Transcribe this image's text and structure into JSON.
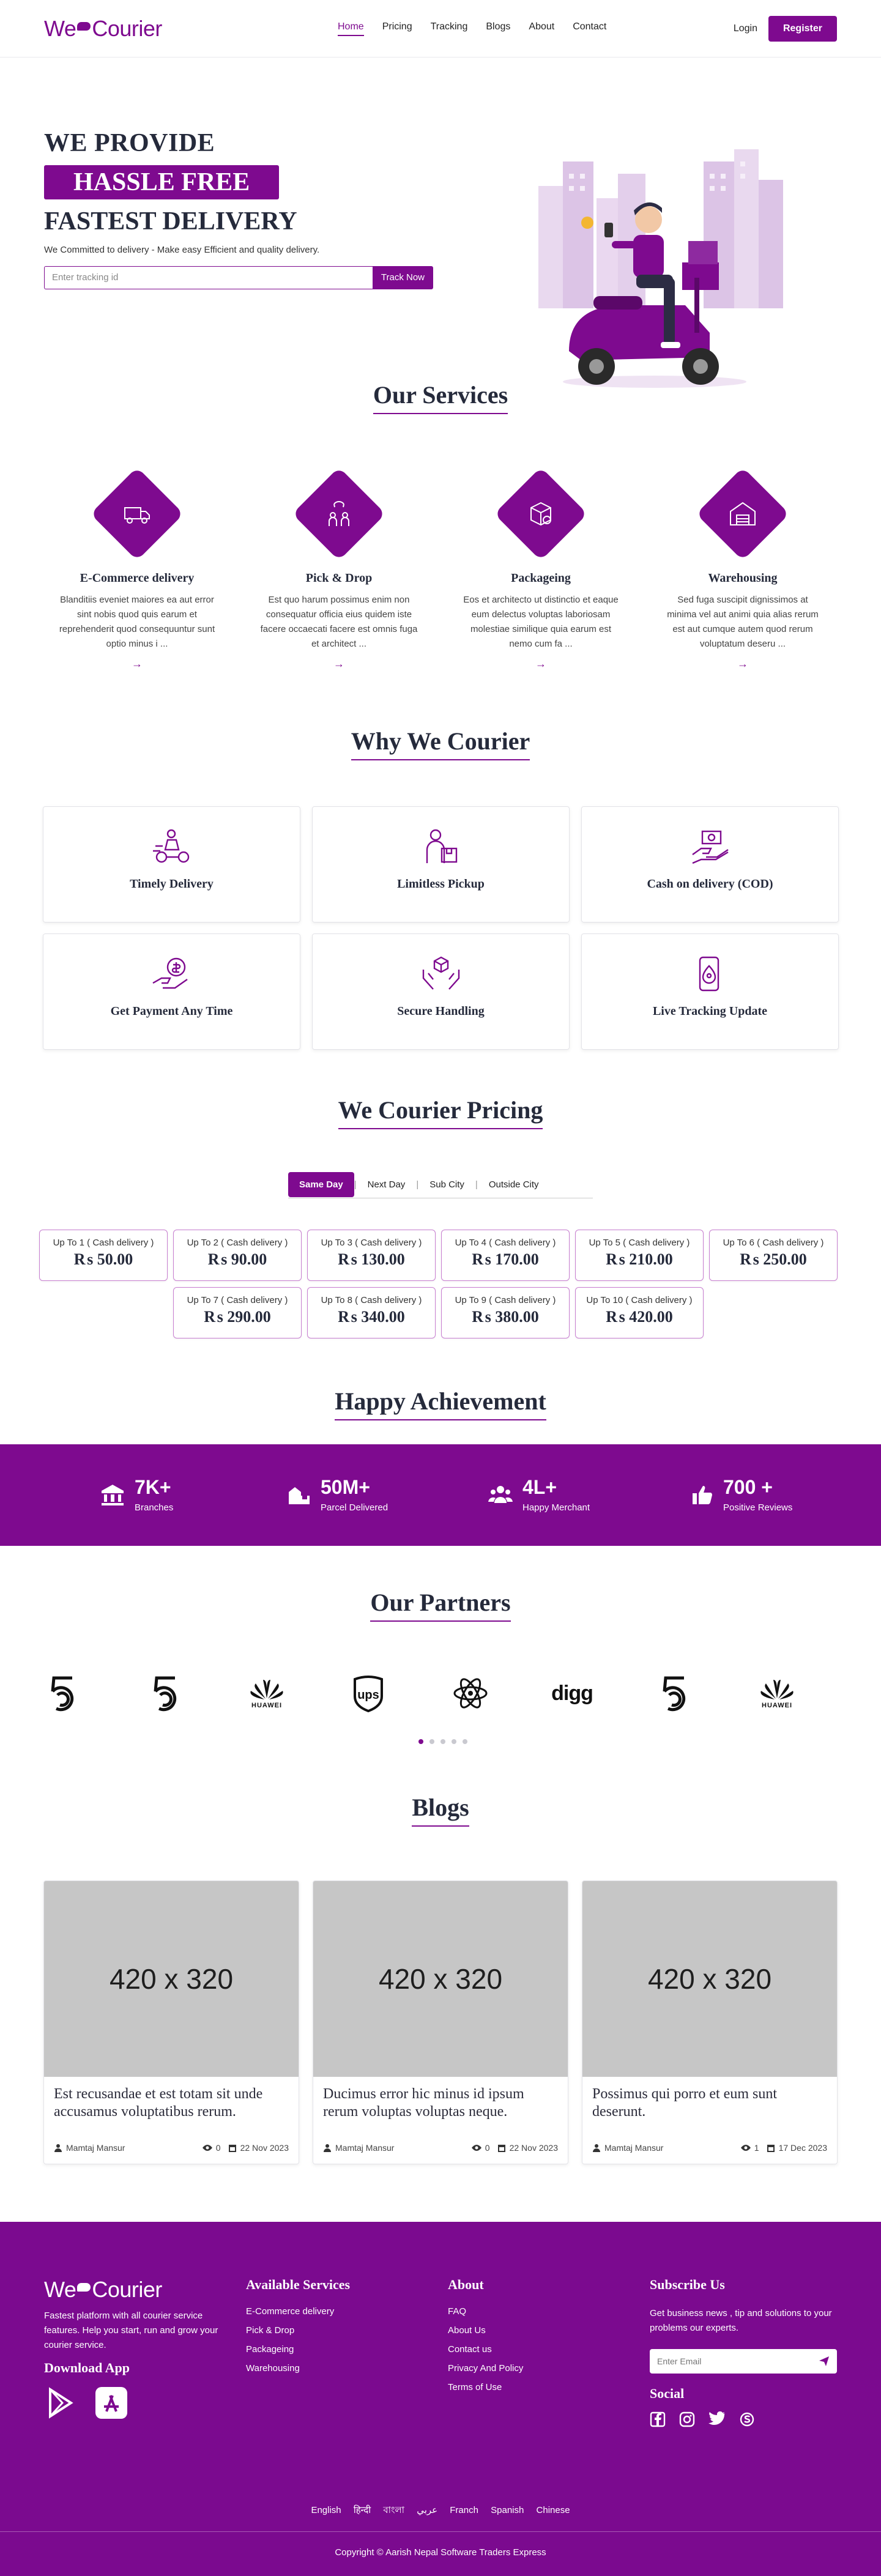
{
  "header": {
    "logo_we": "We",
    "logo_courier": "Courier",
    "menu": [
      "Home",
      "Pricing",
      "Tracking",
      "Blogs",
      "About",
      "Contact"
    ],
    "login": "Login",
    "register": "Register"
  },
  "hero": {
    "line1": "WE PROVIDE",
    "line2": "HASSLE FREE",
    "line3": "FASTEST DELIVERY",
    "subtitle": "We Committed to delivery - Make easy Efficient and quality delivery.",
    "tracking_placeholder": "Enter tracking id",
    "track_button": "Track Now"
  },
  "services": {
    "title": "Our Services",
    "items": [
      {
        "name": "E-Commerce delivery",
        "desc": "Blanditiis eveniet maiores ea aut error sint nobis quod quis earum et reprehenderit quod consequuntur sunt optio minus i ...",
        "icon": "truck-icon"
      },
      {
        "name": "Pick & Drop",
        "desc": "Est quo harum possimus enim non consequatur officia eius quidem iste facere occaecati facere est omnis fuga et architect ...",
        "icon": "pick-drop-icon"
      },
      {
        "name": "Packageing",
        "desc": "Eos et architecto ut distinctio et eaque eum delectus voluptas laboriosam molestiae similique quia earum est nemo cum fa ...",
        "icon": "package-icon"
      },
      {
        "name": "Warehousing",
        "desc": "Sed fuga suscipit dignissimos at minima vel aut animi quia alias rerum est aut cumque autem quod rerum voluptatum deseru ...",
        "icon": "warehouse-icon"
      }
    ]
  },
  "why": {
    "title": "Why We Courier",
    "items": [
      "Timely Delivery",
      "Limitless Pickup",
      "Cash on delivery (COD)",
      "Get Payment Any Time",
      "Secure Handling",
      "Live Tracking Update"
    ]
  },
  "pricing": {
    "title": "We Courier Pricing",
    "tabs": [
      "Same Day",
      "Next Day",
      "Sub City",
      "Outside City"
    ],
    "items": [
      {
        "label": "Up To 1 ( Cash delivery )",
        "price": "₨ 50.00"
      },
      {
        "label": "Up To 2 ( Cash delivery )",
        "price": "₨ 90.00"
      },
      {
        "label": "Up To 3 ( Cash delivery )",
        "price": "₨ 130.00"
      },
      {
        "label": "Up To 4 ( Cash delivery )",
        "price": "₨ 170.00"
      },
      {
        "label": "Up To 5 ( Cash delivery )",
        "price": "₨ 210.00"
      },
      {
        "label": "Up To 6 ( Cash delivery )",
        "price": "₨ 250.00"
      },
      {
        "label": "Up To 7 ( Cash delivery )",
        "price": "₨ 290.00"
      },
      {
        "label": "Up To 8 ( Cash delivery )",
        "price": "₨ 340.00"
      },
      {
        "label": "Up To 9 ( Cash delivery )",
        "price": "₨ 380.00"
      },
      {
        "label": "Up To 10 ( Cash delivery )",
        "price": "₨ 420.00"
      }
    ]
  },
  "achievement": {
    "title": "Happy Achievement",
    "stats": [
      {
        "num": "7K+",
        "cap": "Branches"
      },
      {
        "num": "50M+",
        "cap": "Parcel Delivered"
      },
      {
        "num": "4L+",
        "cap": "Happy Merchant"
      },
      {
        "num": "700 +",
        "cap": "Positive Reviews"
      }
    ]
  },
  "partners": {
    "title": "Our Partners",
    "logos": [
      "5",
      "5",
      "HUAWEI",
      "ups",
      "atom",
      "digg",
      "5",
      "HUAWEI"
    ]
  },
  "blogs": {
    "title": "Blogs",
    "items": [
      {
        "img": "420 x 320",
        "title": "Est recusandae et est totam sit unde accusamus voluptatibus rerum.",
        "author": "Mamtaj Mansur",
        "views": "0",
        "date": "22 Nov 2023"
      },
      {
        "img": "420 x 320",
        "title": "Ducimus error hic minus id ipsum rerum voluptas voluptas neque.",
        "author": "Mamtaj Mansur",
        "views": "0",
        "date": "22 Nov 2023"
      },
      {
        "img": "420 x 320",
        "title": "Possimus qui porro et eum sunt deserunt.",
        "author": "Mamtaj Mansur",
        "views": "1",
        "date": "17 Dec 2023"
      }
    ]
  },
  "footer": {
    "desc": "Fastest platform with all courier service features. Help you start, run and grow your courier service.",
    "download": "Download App",
    "services_title": "Available Services",
    "services": [
      "E-Commerce delivery",
      "Pick & Drop",
      "Packageing",
      "Warehousing"
    ],
    "about_title": "About",
    "about": [
      "FAQ",
      "About Us",
      "Contact us",
      "Privacy And Policy",
      "Terms of Use"
    ],
    "subscribe_title": "Subscribe Us",
    "subscribe_desc": "Get business news , tip and solutions to your problems our experts.",
    "email_placeholder": "Enter Email",
    "social_title": "Social",
    "languages": [
      "English",
      "हिन्दी",
      "বাংলা",
      "عربي",
      "Franch",
      "Spanish",
      "Chinese"
    ],
    "copyright": "Copyright © Aarish Nepal Software Traders Express"
  },
  "colors": {
    "brand": "#7e0a8f"
  }
}
